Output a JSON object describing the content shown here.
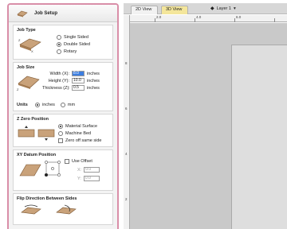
{
  "panel": {
    "title": "Job Setup",
    "job_type": {
      "title": "Job Type",
      "options": [
        "Single Sided",
        "Double Sided",
        "Rotary"
      ],
      "selected": "Double Sided"
    },
    "job_size": {
      "title": "Job Size",
      "width_label": "Width (X):",
      "width_value": "8.0",
      "height_label": "Height (Y):",
      "height_value": "10.0",
      "thickness_label": "Thickness (Z):",
      "thickness_value": "0.5",
      "unit": "inches",
      "units_label": "Units",
      "units_options": [
        "inches",
        "mm"
      ],
      "units_selected": "inches"
    },
    "z_zero": {
      "title": "Z Zero Position",
      "options": [
        "Material Surface",
        "Machine Bed"
      ],
      "selected": "Material Surface",
      "checkbox_label": "Zero off same side"
    },
    "xy_datum": {
      "title": "XY Datum Position",
      "offset_label": "Use Offset",
      "x_label": "X:",
      "x_value": "0.0",
      "y_label": "Y:",
      "y_value": "0.0"
    },
    "flip": {
      "title": "Flip Direction Between Sides"
    }
  },
  "tabs": {
    "tab_2d": "2D View",
    "tab_3d": "3D View",
    "layer_label": "Layer 1"
  },
  "ruler": {
    "top_labels": [
      "2.0",
      "4.0",
      "6.0"
    ],
    "left_labels": [
      "8",
      "6",
      "4",
      "2"
    ]
  },
  "colors": {
    "panel_border": "#d98ea8",
    "selected_field": "#3d7ee0",
    "tab_3d": "#f4e69b",
    "material": "#c9a27a"
  }
}
